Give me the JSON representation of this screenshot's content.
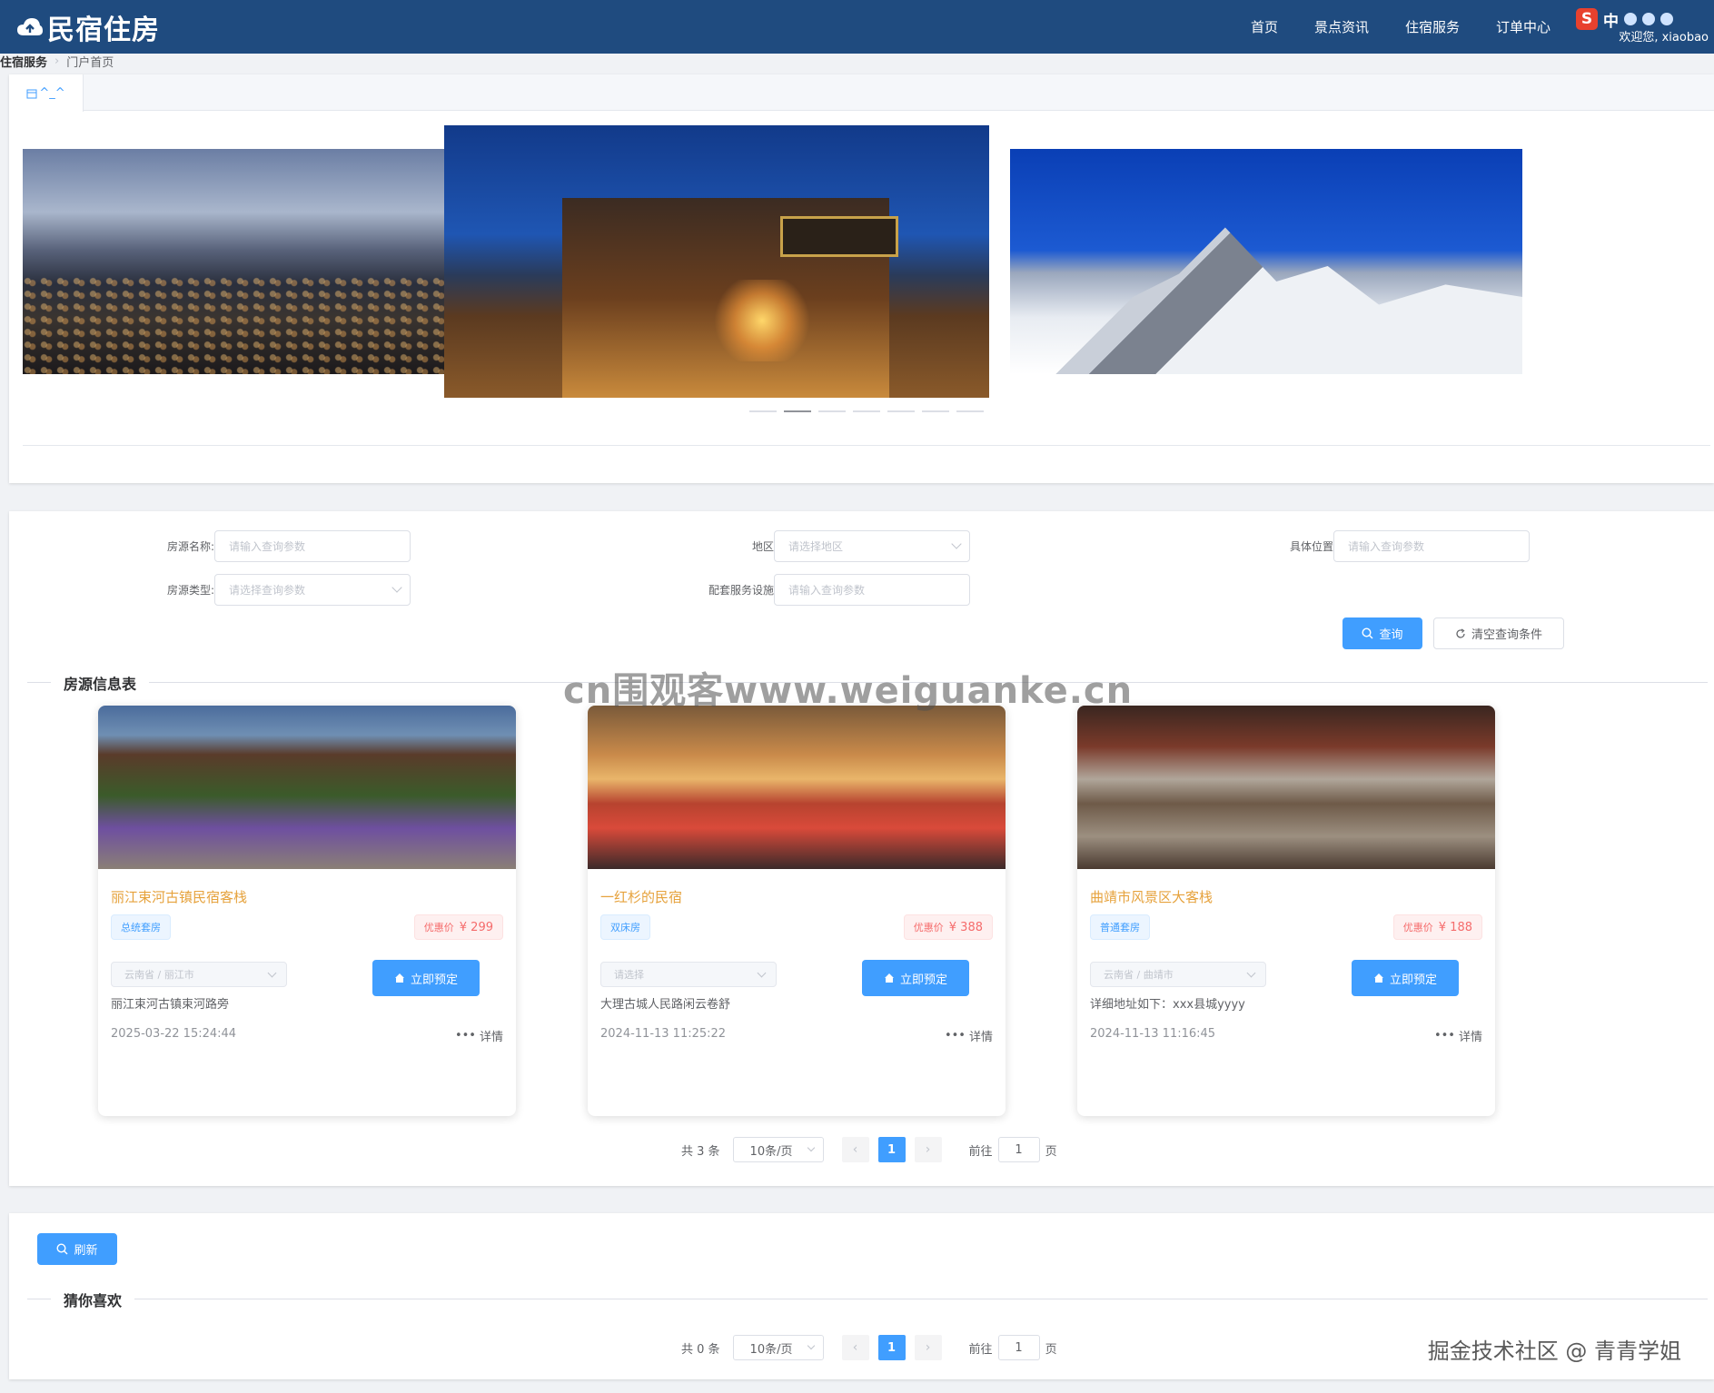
{
  "header": {
    "brand": "民宿住房",
    "nav": [
      "首页",
      "景点资讯",
      "住宿服务",
      "订单中心"
    ],
    "ime_label": "中",
    "greeting": "欢迎您, xiaobao"
  },
  "breadcrumb": {
    "level1": "住宿服务",
    "level2": "门户首页"
  },
  "carousel": {
    "tab_label": "^_^",
    "active_index": 1,
    "dot_count": 7
  },
  "search": {
    "fields": [
      {
        "label": "房源名称:",
        "placeholder": "请输入查询参数"
      },
      {
        "label": "地区:",
        "placeholder": "请选择地区"
      },
      {
        "label": "具体位置:",
        "placeholder": "请输入查询参数"
      },
      {
        "label": "房源类型:",
        "placeholder": "请选择查询参数"
      },
      {
        "label": "配套服务设施:",
        "placeholder": "请输入查询参数"
      }
    ],
    "query_label": "查询",
    "clear_label": "清空查询条件"
  },
  "listing": {
    "title": "房源信息表",
    "cards": [
      {
        "name": "丽江束河古镇民宿客栈",
        "type": "总统套房",
        "price_label": "优惠价",
        "price": "¥ 299",
        "region": "云南省 / 丽江市",
        "book_label": "立即预定",
        "address": "丽江束河古镇束河路旁",
        "time": "2025-03-22 15:24:44",
        "detail_label": "详情"
      },
      {
        "name": "一红杉的民宿",
        "type": "双床房",
        "price_label": "优惠价",
        "price": "¥ 388",
        "region": "请选择",
        "book_label": "立即预定",
        "address": "大理古城人民路闲云卷舒",
        "time": "2024-11-13 11:25:22",
        "detail_label": "详情"
      },
      {
        "name": "曲靖市风景区大客栈",
        "type": "普通套房",
        "price_label": "优惠价",
        "price": "¥ 188",
        "region": "云南省 / 曲靖市",
        "book_label": "立即预定",
        "address": "详细地址如下：xxx县城yyyy",
        "time": "2024-11-13 11:16:45",
        "detail_label": "详情"
      }
    ],
    "pager": {
      "total": "共 3 条",
      "size": "10条/页",
      "page": "1",
      "goto": "前往",
      "goto_value": "1",
      "unit": "页"
    }
  },
  "recommend": {
    "refresh_label": "刷新",
    "title": "猜你喜欢",
    "pager": {
      "total": "共 0 条",
      "size": "10条/页",
      "page": "1",
      "goto": "前往",
      "goto_value": "1",
      "unit": "页"
    }
  },
  "watermark": "cn围观客www.weiguanke.cn",
  "credit": "掘金技术社区 @ 青青学姐"
}
